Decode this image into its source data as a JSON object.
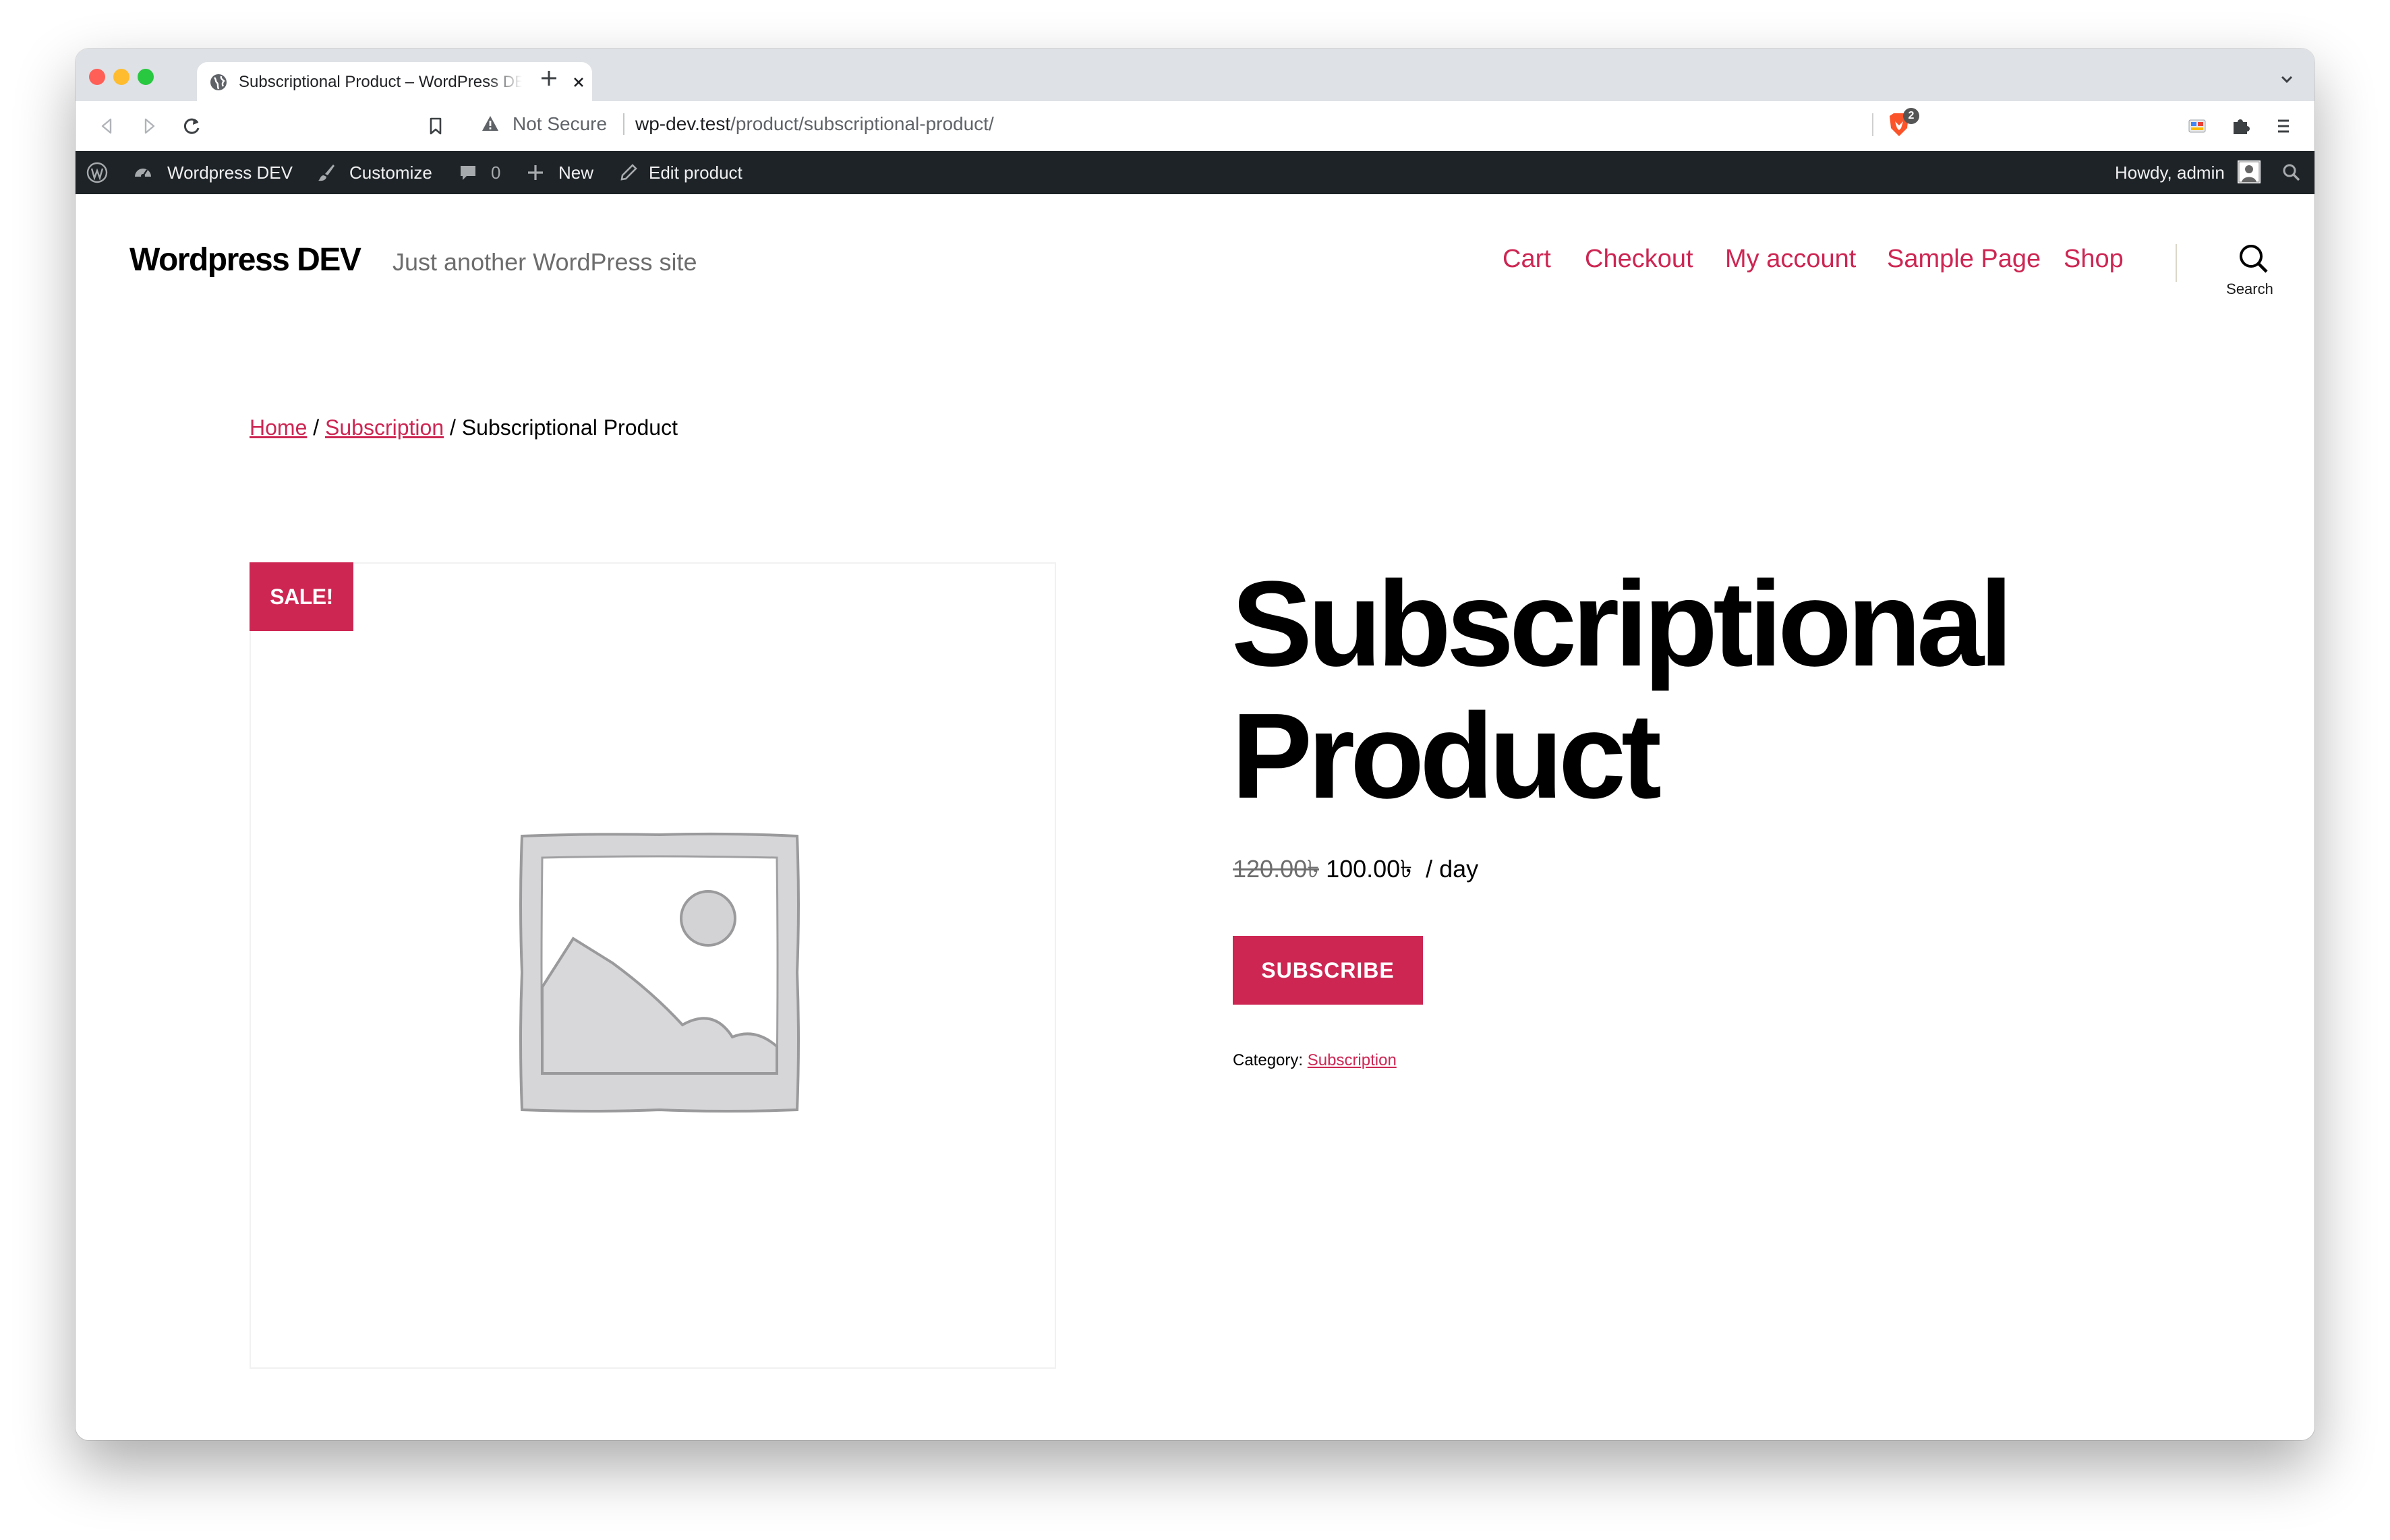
{
  "browser": {
    "tab_title": "Subscriptional Product – WordPress DEV",
    "security_label": "Not Secure",
    "url_host": "wp-dev.test",
    "url_path": "/product/subscriptional-product/",
    "shield_count": "2"
  },
  "admin_bar": {
    "site_name": "Wordpress DEV",
    "customize": "Customize",
    "comments_count": "0",
    "new": "New",
    "edit_product": "Edit product",
    "howdy": "Howdy, admin"
  },
  "site": {
    "title": "Wordpress DEV",
    "tagline": "Just another WordPress site",
    "nav": [
      "Cart",
      "Checkout",
      "My account",
      "Sample Page",
      "Shop"
    ],
    "search_label": "Search"
  },
  "breadcrumb": {
    "home": "Home",
    "sep1": " / ",
    "category": "Subscription",
    "sep2": " / ",
    "current": "Subscriptional Product"
  },
  "product": {
    "sale_badge": "SALE!",
    "title": "Subscriptional Product",
    "regular_price": "120.00৳",
    "sale_price": "100.00৳",
    "period": "/ day",
    "button": "SUBSCRIBE",
    "category_label": "Category:",
    "category": "Subscription"
  },
  "colors": {
    "accent": "#cd2653",
    "admin_bar": "#1d2327",
    "tab_strip": "#dee1e6"
  }
}
